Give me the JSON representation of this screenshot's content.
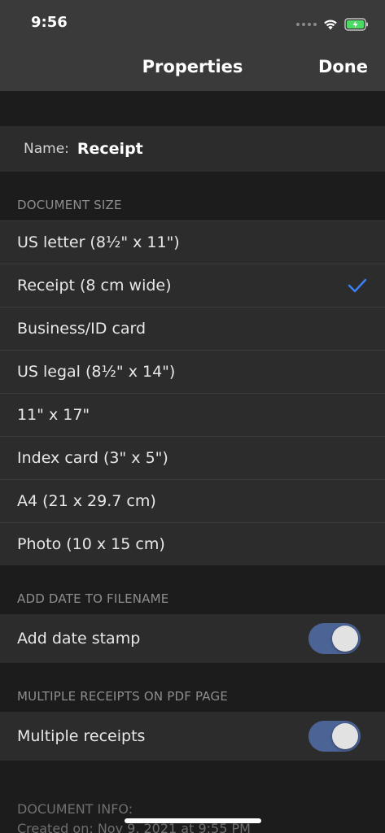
{
  "status_bar": {
    "time": "9:56"
  },
  "nav": {
    "title": "Properties",
    "done_label": "Done"
  },
  "name_field": {
    "label": "Name:",
    "value": "Receipt"
  },
  "document_size": {
    "header": "DOCUMENT SIZE",
    "options": [
      {
        "label": "US letter (8½\" x 11\")",
        "selected": false
      },
      {
        "label": "Receipt (8 cm wide)",
        "selected": true
      },
      {
        "label": "Business/ID card",
        "selected": false
      },
      {
        "label": "US legal (8½\" x 14\")",
        "selected": false
      },
      {
        "label": "11\" x 17\"",
        "selected": false
      },
      {
        "label": "Index card (3\" x 5\")",
        "selected": false
      },
      {
        "label": "A4 (21 x 29.7 cm)",
        "selected": false
      },
      {
        "label": "Photo (10 x 15 cm)",
        "selected": false
      }
    ]
  },
  "date_section": {
    "header": "ADD DATE TO FILENAME",
    "toggle_label": "Add date stamp",
    "enabled": true
  },
  "multi_section": {
    "header": "MULTIPLE RECEIPTS ON PDF PAGE",
    "toggle_label": "Multiple receipts",
    "enabled": true
  },
  "document_info": {
    "header": "DOCUMENT INFO:",
    "created": "Created on: Nov 9, 2021 at 9:55 PM"
  },
  "colors": {
    "accent": "#3a82f7",
    "toggle_on": "#4b6395"
  }
}
